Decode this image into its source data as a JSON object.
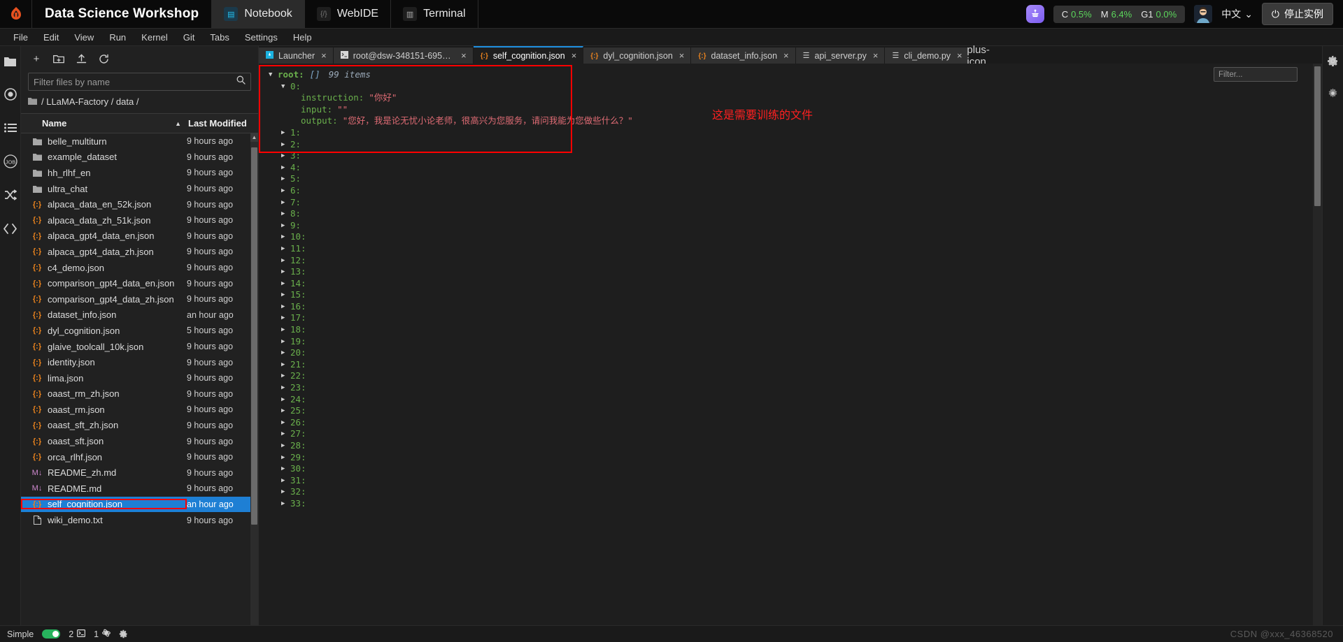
{
  "brand": {
    "logo_icon": "flame-logo-icon",
    "title": "Data Science Workshop",
    "apps": [
      {
        "label": "Notebook",
        "icon": "notebook-icon",
        "active": true
      },
      {
        "label": "WebIDE",
        "icon": "code-brackets-icon",
        "active": false
      },
      {
        "label": "Terminal",
        "icon": "terminal-icon",
        "active": false
      }
    ],
    "robot_icon": "ai-assistant-icon",
    "metrics": [
      {
        "label": "C",
        "value": "0.5%"
      },
      {
        "label": "M",
        "value": "6.4%"
      },
      {
        "label": "G1",
        "value": "0.0%"
      }
    ],
    "avatar_icon": "user-avatar",
    "language": "中文",
    "language_chevron": "chevron-down-icon",
    "stop_button": {
      "label": "停止实例",
      "icon": "power-icon"
    }
  },
  "menubar": {
    "items": [
      "File",
      "Edit",
      "View",
      "Run",
      "Kernel",
      "Git",
      "Tabs",
      "Settings",
      "Help"
    ]
  },
  "left_rail": {
    "items": [
      {
        "icon": "folder-icon",
        "name": "file-browser"
      },
      {
        "icon": "record-circle-icon",
        "name": "running-kernels"
      },
      {
        "icon": "list-icon",
        "name": "table-of-contents"
      },
      {
        "icon": "job-icon",
        "name": "jobs"
      },
      {
        "icon": "shuffle-icon",
        "name": "git-panel"
      },
      {
        "icon": "code-icon",
        "name": "extensions"
      }
    ]
  },
  "right_rail": {
    "items": [
      {
        "icon": "gear-icon",
        "name": "settings"
      },
      {
        "icon": "gear-alt-icon",
        "name": "property-inspector"
      }
    ]
  },
  "filebrowser": {
    "toolbar": [
      {
        "icon": "plus-icon",
        "name": "new-launcher"
      },
      {
        "icon": "new-folder-icon",
        "name": "new-folder"
      },
      {
        "icon": "upload-icon",
        "name": "upload"
      },
      {
        "icon": "refresh-icon",
        "name": "refresh"
      }
    ],
    "search_placeholder": "Filter files by name",
    "search_value": "",
    "search_icon": "search-icon",
    "breadcrumb": "/ LLaMA-Factory / data /",
    "breadcrumb_folder_icon": "folder-icon",
    "columns": {
      "name": "Name",
      "modified": "Last Modified"
    },
    "sort_icon": "sort-asc-icon",
    "rows": [
      {
        "name": "belle_multiturn",
        "type": "folder",
        "modified": "9 hours ago"
      },
      {
        "name": "example_dataset",
        "type": "folder",
        "modified": "9 hours ago"
      },
      {
        "name": "hh_rlhf_en",
        "type": "folder",
        "modified": "9 hours ago"
      },
      {
        "name": "ultra_chat",
        "type": "folder",
        "modified": "9 hours ago"
      },
      {
        "name": "alpaca_data_en_52k.json",
        "type": "json",
        "modified": "9 hours ago"
      },
      {
        "name": "alpaca_data_zh_51k.json",
        "type": "json",
        "modified": "9 hours ago"
      },
      {
        "name": "alpaca_gpt4_data_en.json",
        "type": "json",
        "modified": "9 hours ago"
      },
      {
        "name": "alpaca_gpt4_data_zh.json",
        "type": "json",
        "modified": "9 hours ago"
      },
      {
        "name": "c4_demo.json",
        "type": "json",
        "modified": "9 hours ago"
      },
      {
        "name": "comparison_gpt4_data_en.json",
        "type": "json",
        "modified": "9 hours ago"
      },
      {
        "name": "comparison_gpt4_data_zh.json",
        "type": "json",
        "modified": "9 hours ago"
      },
      {
        "name": "dataset_info.json",
        "type": "json",
        "modified": "an hour ago"
      },
      {
        "name": "dyl_cognition.json",
        "type": "json",
        "modified": "5 hours ago"
      },
      {
        "name": "glaive_toolcall_10k.json",
        "type": "json",
        "modified": "9 hours ago"
      },
      {
        "name": "identity.json",
        "type": "json",
        "modified": "9 hours ago"
      },
      {
        "name": "lima.json",
        "type": "json",
        "modified": "9 hours ago"
      },
      {
        "name": "oaast_rm_zh.json",
        "type": "json",
        "modified": "9 hours ago"
      },
      {
        "name": "oaast_rm.json",
        "type": "json",
        "modified": "9 hours ago"
      },
      {
        "name": "oaast_sft_zh.json",
        "type": "json",
        "modified": "9 hours ago"
      },
      {
        "name": "oaast_sft.json",
        "type": "json",
        "modified": "9 hours ago"
      },
      {
        "name": "orca_rlhf.json",
        "type": "json",
        "modified": "9 hours ago"
      },
      {
        "name": "README_zh.md",
        "type": "md",
        "modified": "9 hours ago"
      },
      {
        "name": "README.md",
        "type": "md",
        "modified": "9 hours ago"
      },
      {
        "name": "self_cognition.json",
        "type": "json",
        "modified": "an hour ago",
        "selected": true
      },
      {
        "name": "wiki_demo.txt",
        "type": "txt",
        "modified": "9 hours ago"
      }
    ]
  },
  "editor_tabs": [
    {
      "label": "Launcher",
      "icon": "launcher-icon",
      "close": "×",
      "active": false
    },
    {
      "label": "root@dsw-348151-69568...",
      "icon": "terminal-icon",
      "close": "×",
      "active": false
    },
    {
      "label": "self_cognition.json",
      "icon": "json-icon",
      "close": "×",
      "active": true
    },
    {
      "label": "dyl_cognition.json",
      "icon": "json-icon",
      "close": "×",
      "active": false
    },
    {
      "label": "dataset_info.json",
      "icon": "json-icon",
      "close": "×",
      "active": false
    },
    {
      "label": "api_server.py",
      "icon": "python-icon",
      "close": "×",
      "active": false
    },
    {
      "label": "cli_demo.py",
      "icon": "python-icon",
      "close": "×",
      "active": false
    }
  ],
  "tab_add_icon": "plus-icon",
  "json_viewer": {
    "filter_placeholder": "Filter...",
    "filter_value": "",
    "filter_icon": "search-icon",
    "root": {
      "caret": "▼",
      "key": "root:",
      "type": "[]",
      "count": "99 items"
    },
    "item0": {
      "caret": "▼",
      "index": "0:",
      "fields": [
        {
          "key": "instruction:",
          "value": "\"你好\""
        },
        {
          "key": "input:",
          "value": "\"\""
        },
        {
          "key": "output:",
          "value": "\"您好，我是论无忧小论老师，很高兴为您服务，请问我能为您做些什么？\""
        }
      ]
    },
    "collapsed_items": [
      "1:",
      "2:",
      "3:",
      "4:",
      "5:",
      "6:",
      "7:",
      "8:",
      "9:",
      "10:",
      "11:",
      "12:",
      "13:",
      "14:",
      "15:",
      "16:",
      "17:",
      "18:",
      "19:",
      "20:",
      "21:",
      "22:",
      "23:",
      "24:",
      "25:",
      "26:",
      "27:",
      "28:",
      "29:",
      "30:",
      "31:",
      "32:",
      "33:"
    ],
    "collapsed_caret": "▶"
  },
  "annotation": {
    "text": "这是需要训练的文件",
    "color": "#ff2020"
  },
  "statusbar": {
    "mode_label": "Simple",
    "toggle_on": true,
    "terminals_count": "2",
    "terminals_icon": "terminal-icon",
    "kernels_count": "1",
    "kernels_icon": "kernel-icon",
    "settings_icon": "gear-icon"
  },
  "watermark": "CSDN @xxx_46368520"
}
